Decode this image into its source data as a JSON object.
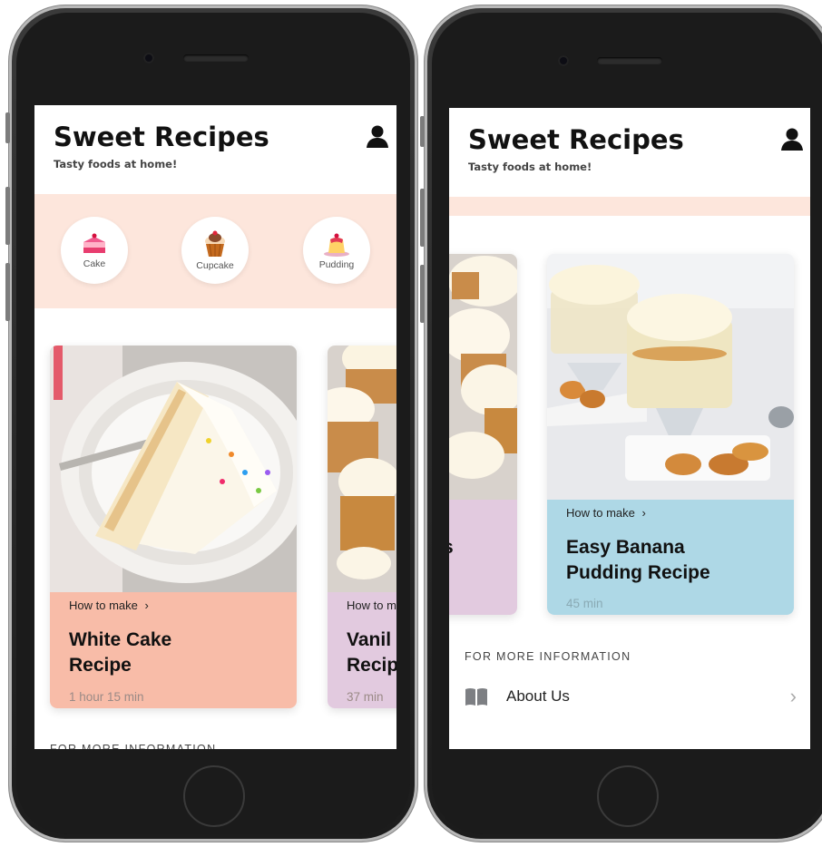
{
  "app": {
    "title": "Sweet Recipes",
    "subtitle": "Tasty foods at home!",
    "user_icon": "user-icon"
  },
  "categories": [
    {
      "label": "Cake",
      "icon": "cake-icon"
    },
    {
      "label": "Cupcake",
      "icon": "cupcake-icon"
    },
    {
      "label": "Pudding",
      "icon": "pudding-icon"
    }
  ],
  "recipes": [
    {
      "how": "How to make",
      "title_line1": "White Cake",
      "title_line2": "Recipe",
      "duration": "1 hour 15 min",
      "color": "#f8bca8"
    },
    {
      "how": "How to m",
      "title_line1": "Vanil",
      "title_line2": "Recip",
      "duration": "37 min",
      "color": "#e2cadf"
    },
    {
      "how": "How to make",
      "title_line1": "Easy Banana",
      "title_line2": "Pudding Recipe",
      "duration": "45 min",
      "color": "#aed8e6"
    }
  ],
  "second_screen_partial_text": "s",
  "more_info": {
    "heading": "FOR MORE INFORMATION",
    "about_label": "About Us",
    "about_icon": "book-icon",
    "chevron_icon": "chevron-right-icon"
  }
}
